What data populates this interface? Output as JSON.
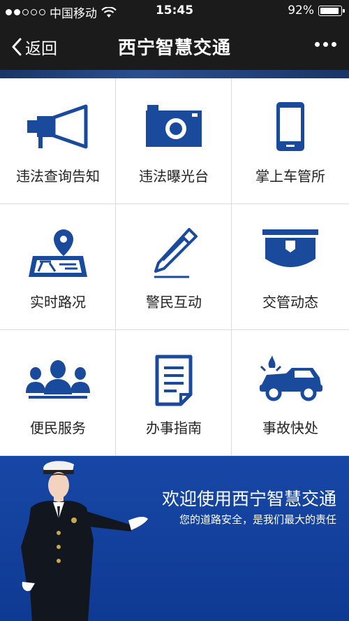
{
  "status_bar": {
    "carrier": "中国移动",
    "time": "15:45",
    "battery": "92%",
    "battery_level": 0.92
  },
  "nav": {
    "back_label": "返回",
    "title": "西宁智慧交通"
  },
  "menu": [
    {
      "label": "违法查询告知",
      "icon": "megaphone-icon"
    },
    {
      "label": "违法曝光台",
      "icon": "camera-icon"
    },
    {
      "label": "掌上车管所",
      "icon": "phone-icon"
    },
    {
      "label": "实时路况",
      "icon": "map-pin-icon"
    },
    {
      "label": "警民互动",
      "icon": "pen-icon"
    },
    {
      "label": "交管动态",
      "icon": "police-cap-icon"
    },
    {
      "label": "便民服务",
      "icon": "people-icon"
    },
    {
      "label": "办事指南",
      "icon": "document-icon"
    },
    {
      "label": "事故快处",
      "icon": "car-accident-icon"
    }
  ],
  "banner": {
    "title": "欢迎使用西宁智慧交通",
    "subtitle": "您的道路安全，是我们最大的责任"
  },
  "colors": {
    "icon_blue": "#1a4a9c",
    "bar_dark": "#1b1b1b",
    "banner_blue": "#1747a6"
  }
}
